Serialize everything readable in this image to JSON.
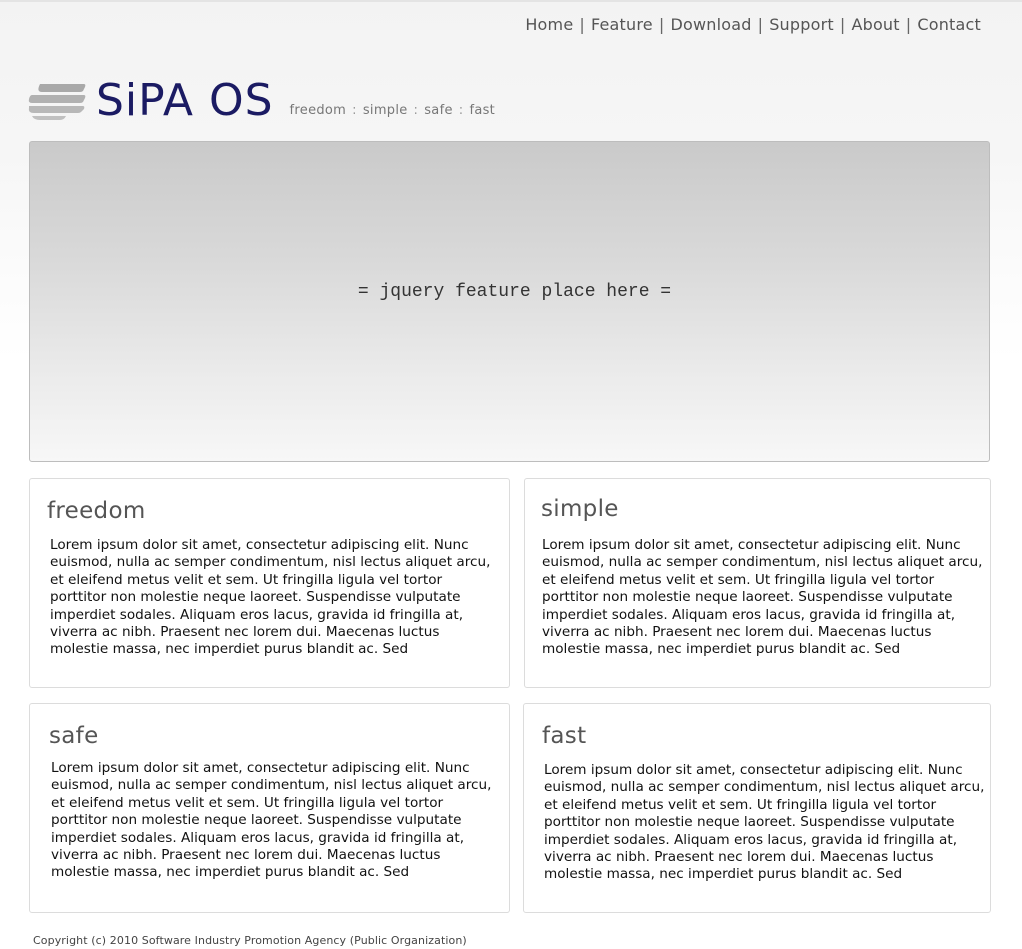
{
  "nav": {
    "items": [
      "Home",
      "Feature",
      "Download",
      "Support",
      "About",
      "Contact"
    ],
    "separator": "|"
  },
  "brand": {
    "name": "SiPA OS",
    "tagline": [
      "freedom",
      "simple",
      "safe",
      "fast"
    ],
    "tagline_separator": ":",
    "brand_color": "#1b1b63"
  },
  "feature": {
    "placeholder": "= jquery feature place here ="
  },
  "cards": [
    {
      "title": "freedom",
      "body": "Lorem ipsum dolor sit amet, consectetur adipiscing elit. Nunc euismod, nulla ac semper condimentum, nisl lectus aliquet arcu, et eleifend metus velit et sem. Ut fringilla ligula vel tortor porttitor non molestie neque laoreet. Suspendisse vulputate imperdiet sodales. Aliquam eros lacus, gravida id fringilla at, viverra ac nibh. Praesent nec lorem dui. Maecenas luctus molestie massa, nec imperdiet purus blandit ac. Sed"
    },
    {
      "title": "simple",
      "body": "Lorem ipsum dolor sit amet, consectetur adipiscing elit. Nunc euismod, nulla ac semper condimentum, nisl lectus aliquet arcu, et eleifend metus velit et sem. Ut fringilla ligula vel tortor porttitor non molestie neque laoreet. Suspendisse vulputate imperdiet sodales. Aliquam eros lacus, gravida id fringilla at, viverra ac nibh. Praesent nec lorem dui. Maecenas luctus molestie massa, nec imperdiet purus blandit ac. Sed"
    },
    {
      "title": "safe",
      "body": "Lorem ipsum dolor sit amet, consectetur adipiscing elit. Nunc euismod, nulla ac semper condimentum, nisl lectus aliquet arcu, et eleifend metus velit et sem. Ut fringilla ligula vel tortor porttitor non molestie neque laoreet. Suspendisse vulputate imperdiet sodales. Aliquam eros lacus, gravida id fringilla at, viverra ac nibh. Praesent nec lorem dui. Maecenas luctus molestie massa, nec imperdiet purus blandit ac. Sed"
    },
    {
      "title": "fast",
      "body": "Lorem ipsum dolor sit amet, consectetur adipiscing elit. Nunc euismod, nulla ac semper condimentum, nisl lectus aliquet arcu, et eleifend metus velit et sem. Ut fringilla ligula vel tortor porttitor non molestie neque laoreet. Suspendisse vulputate imperdiet sodales. Aliquam eros lacus, gravida id fringilla at, viverra ac nibh. Praesent nec lorem dui. Maecenas luctus molestie massa, nec imperdiet purus blandit ac. Sed"
    }
  ],
  "footer": {
    "copyright": "Copyright (c) 2010 Software Industry Promotion Agency (Public Organization)"
  }
}
